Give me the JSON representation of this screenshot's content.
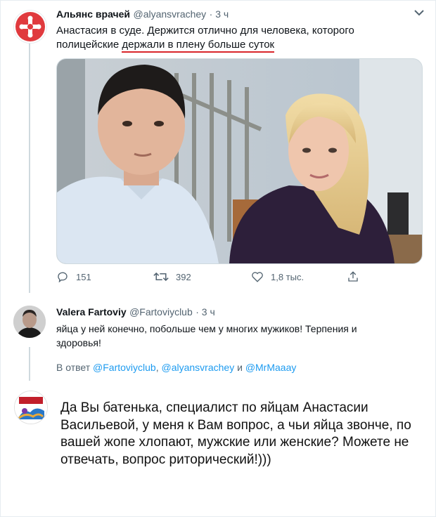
{
  "tweet1": {
    "author_name": "Альянс врачей",
    "handle": "@alyansvrachey",
    "time": "· 3 ч",
    "text_part1": "Анастасия в суде. Держится отлично для человека, которого полицейские ",
    "text_underlined": "держали в плену больше суток",
    "stats": {
      "replies": "151",
      "retweets": "392",
      "likes": "1,8 тыс."
    }
  },
  "tweet2": {
    "author_name": "Valera Fartoviy",
    "handle": "@Fartoviyclub",
    "time": "· 3 ч",
    "text": "яйца у ней конечно, побольше чем у многих мужиков! Терпения и здоровья!",
    "reply_prefix": "В ответ ",
    "reply_user1": "@Fartoviyclub",
    "reply_sep1": ", ",
    "reply_user2": "@alyansvrachey",
    "reply_sep2": " и ",
    "reply_user3": "@MrMaaay"
  },
  "comment": {
    "text": "Да Вы батенька, специалист по яйцам Анастасии Васильевой, у меня  к Вам вопрос, а чьи яйца звонче, по вашей жопе хлопают, мужские или женские? Можете не отвечать, вопрос риторический!)))"
  },
  "colors": {
    "accent": "#1d9bf0",
    "underline": "#d9262b",
    "muted": "#536471"
  },
  "icons": [
    "logo-cross-icon",
    "chevron-down-icon",
    "reply-icon",
    "retweet-icon",
    "like-icon",
    "share-icon"
  ]
}
